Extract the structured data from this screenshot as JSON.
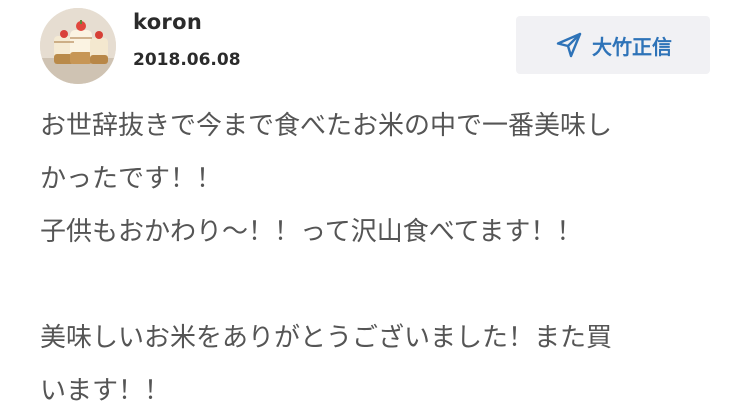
{
  "review": {
    "user_name": "koron",
    "date": "2018.06.08",
    "reply_button_label": "大竹正信",
    "reply_icon": "send-icon",
    "lines": [
      "お世辞抜きで今まで食べたお米の中で一番美味し",
      "かったです！！",
      "子供もおかわり〜！！って沢山食べてます！！",
      "",
      "美味しいお米をありがとうございました！また買",
      "います！！"
    ]
  },
  "colors": {
    "accent": "#2e73b8",
    "button_bg": "#f1f1f4",
    "body_text": "#555555",
    "heading_text": "#2b2b2b"
  }
}
